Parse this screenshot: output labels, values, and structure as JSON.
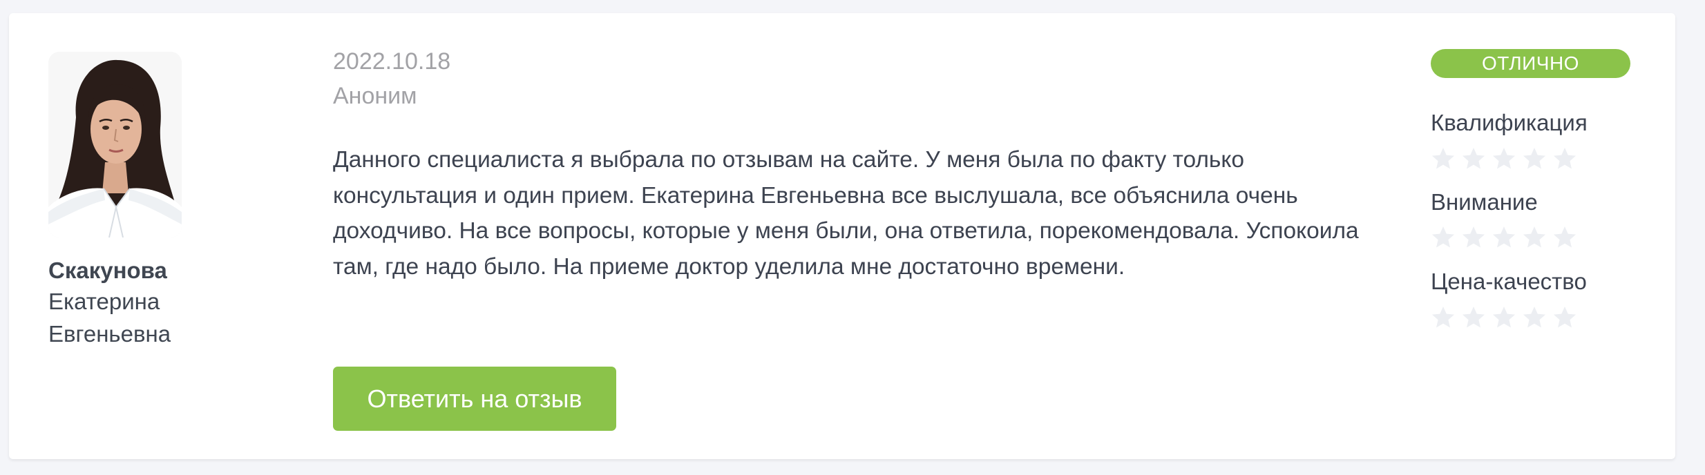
{
  "doctor": {
    "last_name": "Скакунова",
    "first_name": "Екатерина",
    "patronymic": "Евгеньевна",
    "photo_icon": "doctor-portrait"
  },
  "review": {
    "date": "2022.10.18",
    "author": "Аноним",
    "text": "Данного специалиста я выбрала по отзывам на сайте. У меня была по факту только консультация и один прием. Екатерина Евгеньевна все выслушала, все объяснила очень доходчиво. На все вопросы, которые у меня были, она ответила, порекомендовала. Успокоила там, где надо было. На приеме доктор уделила мне достаточно времени.",
    "reply_button_label": "Ответить на отзыв"
  },
  "rating": {
    "badge_label": "ОТЛИЧНО",
    "badge_color": "#8bc34a",
    "criteria": [
      {
        "label": "Квалификация",
        "stars_filled": 0,
        "stars_total": 5
      },
      {
        "label": "Внимание",
        "stars_filled": 0,
        "stars_total": 5
      },
      {
        "label": "Цена-качество",
        "stars_filled": 0,
        "stars_total": 5
      }
    ],
    "star_empty_color": "#eceef2"
  }
}
